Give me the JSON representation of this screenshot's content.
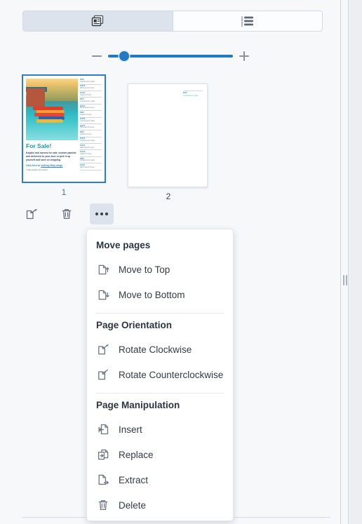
{
  "panel": {
    "view_toggle": {
      "options": [
        {
          "id": "thumbnail-view",
          "icon": "page-thumbnails-icon",
          "selected": true
        },
        {
          "id": "list-view",
          "icon": "list-view-icon",
          "selected": false
        }
      ]
    },
    "zoom": {
      "decrease_icon": "minus-icon",
      "increase_icon": "plus-icon",
      "value_percent": 13
    },
    "pages": [
      {
        "number": "1",
        "selected": true,
        "content": {
          "title": "For Sale!",
          "body": "Kayaks and canoes for sale, custom painted and delivered to your door or pick it up yourself and save on shipping.",
          "link_prefix": "Click here to",
          "link_text": "visit my Etsy shop!",
          "caption": "I make kayaks and canoes.",
          "sidebar_entries": [
            {
              "line1": "$950",
              "line2": "(Cedarwood Lake)"
            },
            {
              "line1": "$1200",
              "line2": "(Birchwood Cove)"
            },
            {
              "line1": "$1100",
              "line2": "(Harbor Point)"
            },
            {
              "line1": "$875",
              "line2": "(Cedarwood Lake)"
            },
            {
              "line1": "$1350",
              "line2": "(Birchwood Cove)"
            },
            {
              "line1": "$980",
              "line2": "(Harbor Point)"
            },
            {
              "line1": "$1050",
              "line2": "(Cedarwood Lake)"
            },
            {
              "line1": "$1275",
              "line2": "(Birchwood Cove)"
            },
            {
              "line1": "$900",
              "line2": "(Harbor Point)"
            },
            {
              "line1": "$1150",
              "line2": "(Cedarwood Lake)"
            },
            {
              "line1": "$1025",
              "line2": "(Birchwood Cove)"
            },
            {
              "line1": "$1400",
              "line2": "(Harbor Point)"
            },
            {
              "line1": "$860",
              "line2": "(Cedarwood Lake)"
            },
            {
              "line1": "$1190",
              "line2": "(Birchwood Cove)"
            }
          ]
        }
      },
      {
        "number": "2",
        "selected": false,
        "content": {
          "header_line1": "$950",
          "header_line2": "(Cedarwood Lake)"
        }
      }
    ],
    "actions": [
      {
        "id": "rotate-page",
        "icon": "rotate-page-icon",
        "active": false
      },
      {
        "id": "delete-page",
        "icon": "trash-icon",
        "active": false
      },
      {
        "id": "more-options",
        "icon": "ellipsis-icon",
        "active": true
      }
    ],
    "resize_handle_icon": "panel-resize-handle-icon"
  },
  "menu": {
    "sections": [
      {
        "header": "Move pages",
        "items": [
          {
            "label": "Move to Top",
            "icon": "page-arrow-up-icon"
          },
          {
            "label": "Move to Bottom",
            "icon": "page-arrow-down-icon"
          }
        ]
      },
      {
        "header": "Page Orientation",
        "items": [
          {
            "label": "Rotate Clockwise",
            "icon": "rotate-clockwise-icon"
          },
          {
            "label": "Rotate Counterclockwise",
            "icon": "rotate-counterclockwise-icon"
          }
        ]
      },
      {
        "header": "Page Manipulation",
        "items": [
          {
            "label": "Insert",
            "icon": "insert-page-icon"
          },
          {
            "label": "Replace",
            "icon": "replace-page-icon"
          },
          {
            "label": "Extract",
            "icon": "extract-page-icon"
          },
          {
            "label": "Delete",
            "icon": "trash-icon"
          }
        ]
      }
    ]
  },
  "colors": {
    "accent": "#2279c4",
    "selection_border": "#2b7cd3",
    "panel_bg": "#f6f8fa",
    "segment_active_bg": "#dde3ec",
    "icon_gray": "#6b7480"
  }
}
